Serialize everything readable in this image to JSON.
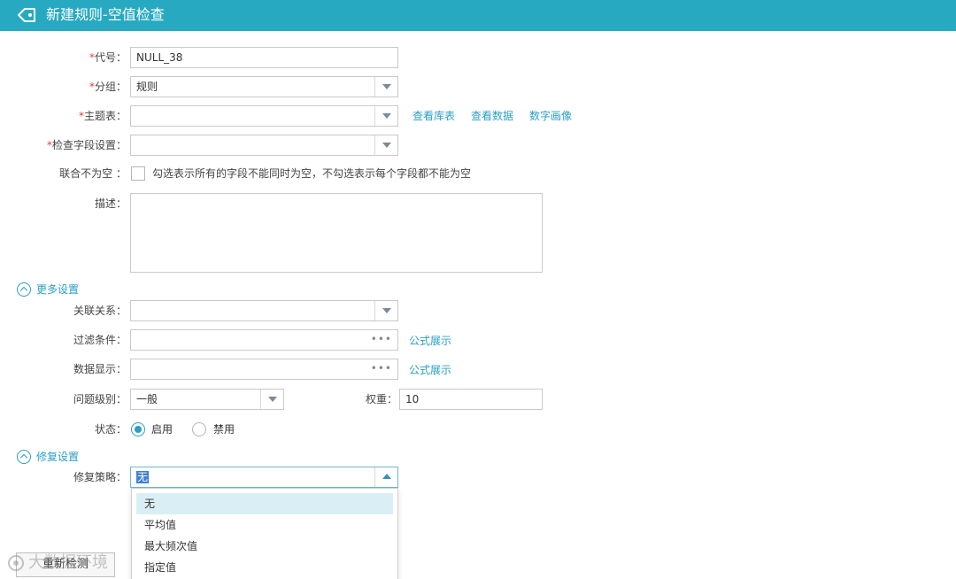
{
  "header": {
    "title": "新建规则-空值检查",
    "icon": "tag-icon"
  },
  "form": {
    "code": {
      "required": "*",
      "label": "代号：",
      "value": "NULL_38"
    },
    "group": {
      "required": "*",
      "label": "分组：",
      "value": "规则"
    },
    "theme_table": {
      "required": "*",
      "label": "主题表：",
      "value": "",
      "links": [
        "查看库表",
        "查看数据",
        "数字画像"
      ]
    },
    "check_field": {
      "required": "*",
      "label": "检查字段设置：",
      "value": ""
    },
    "joint_not_null": {
      "label": "联合不为空 ：",
      "hint": "勾选表示所有的字段不能同时为空，不勾选表示每个字段都不能为空"
    },
    "description": {
      "label": "描述："
    }
  },
  "more_settings": {
    "title": "更多设置",
    "relation": {
      "label": "关联关系：",
      "value": ""
    },
    "filter": {
      "label": "过滤条件：",
      "dots": "•••",
      "link": "公式展示"
    },
    "data_display": {
      "label": "数据显示：",
      "dots": "•••",
      "link": "公式展示"
    },
    "level": {
      "label": "问题级别：",
      "value": "一般"
    },
    "weight": {
      "label": "权重：",
      "value": "10"
    },
    "status": {
      "label": "状态：",
      "options": [
        "启用",
        "禁用"
      ],
      "selected": "启用"
    }
  },
  "repair_settings": {
    "title": "修复设置",
    "strategy": {
      "label": "修复策略：",
      "value": "无"
    },
    "options": [
      "无",
      "平均值",
      "最大频次值",
      "指定值"
    ],
    "active_option": "无"
  },
  "footer": {
    "button": "重新检测"
  },
  "watermark": "大数据环境"
}
